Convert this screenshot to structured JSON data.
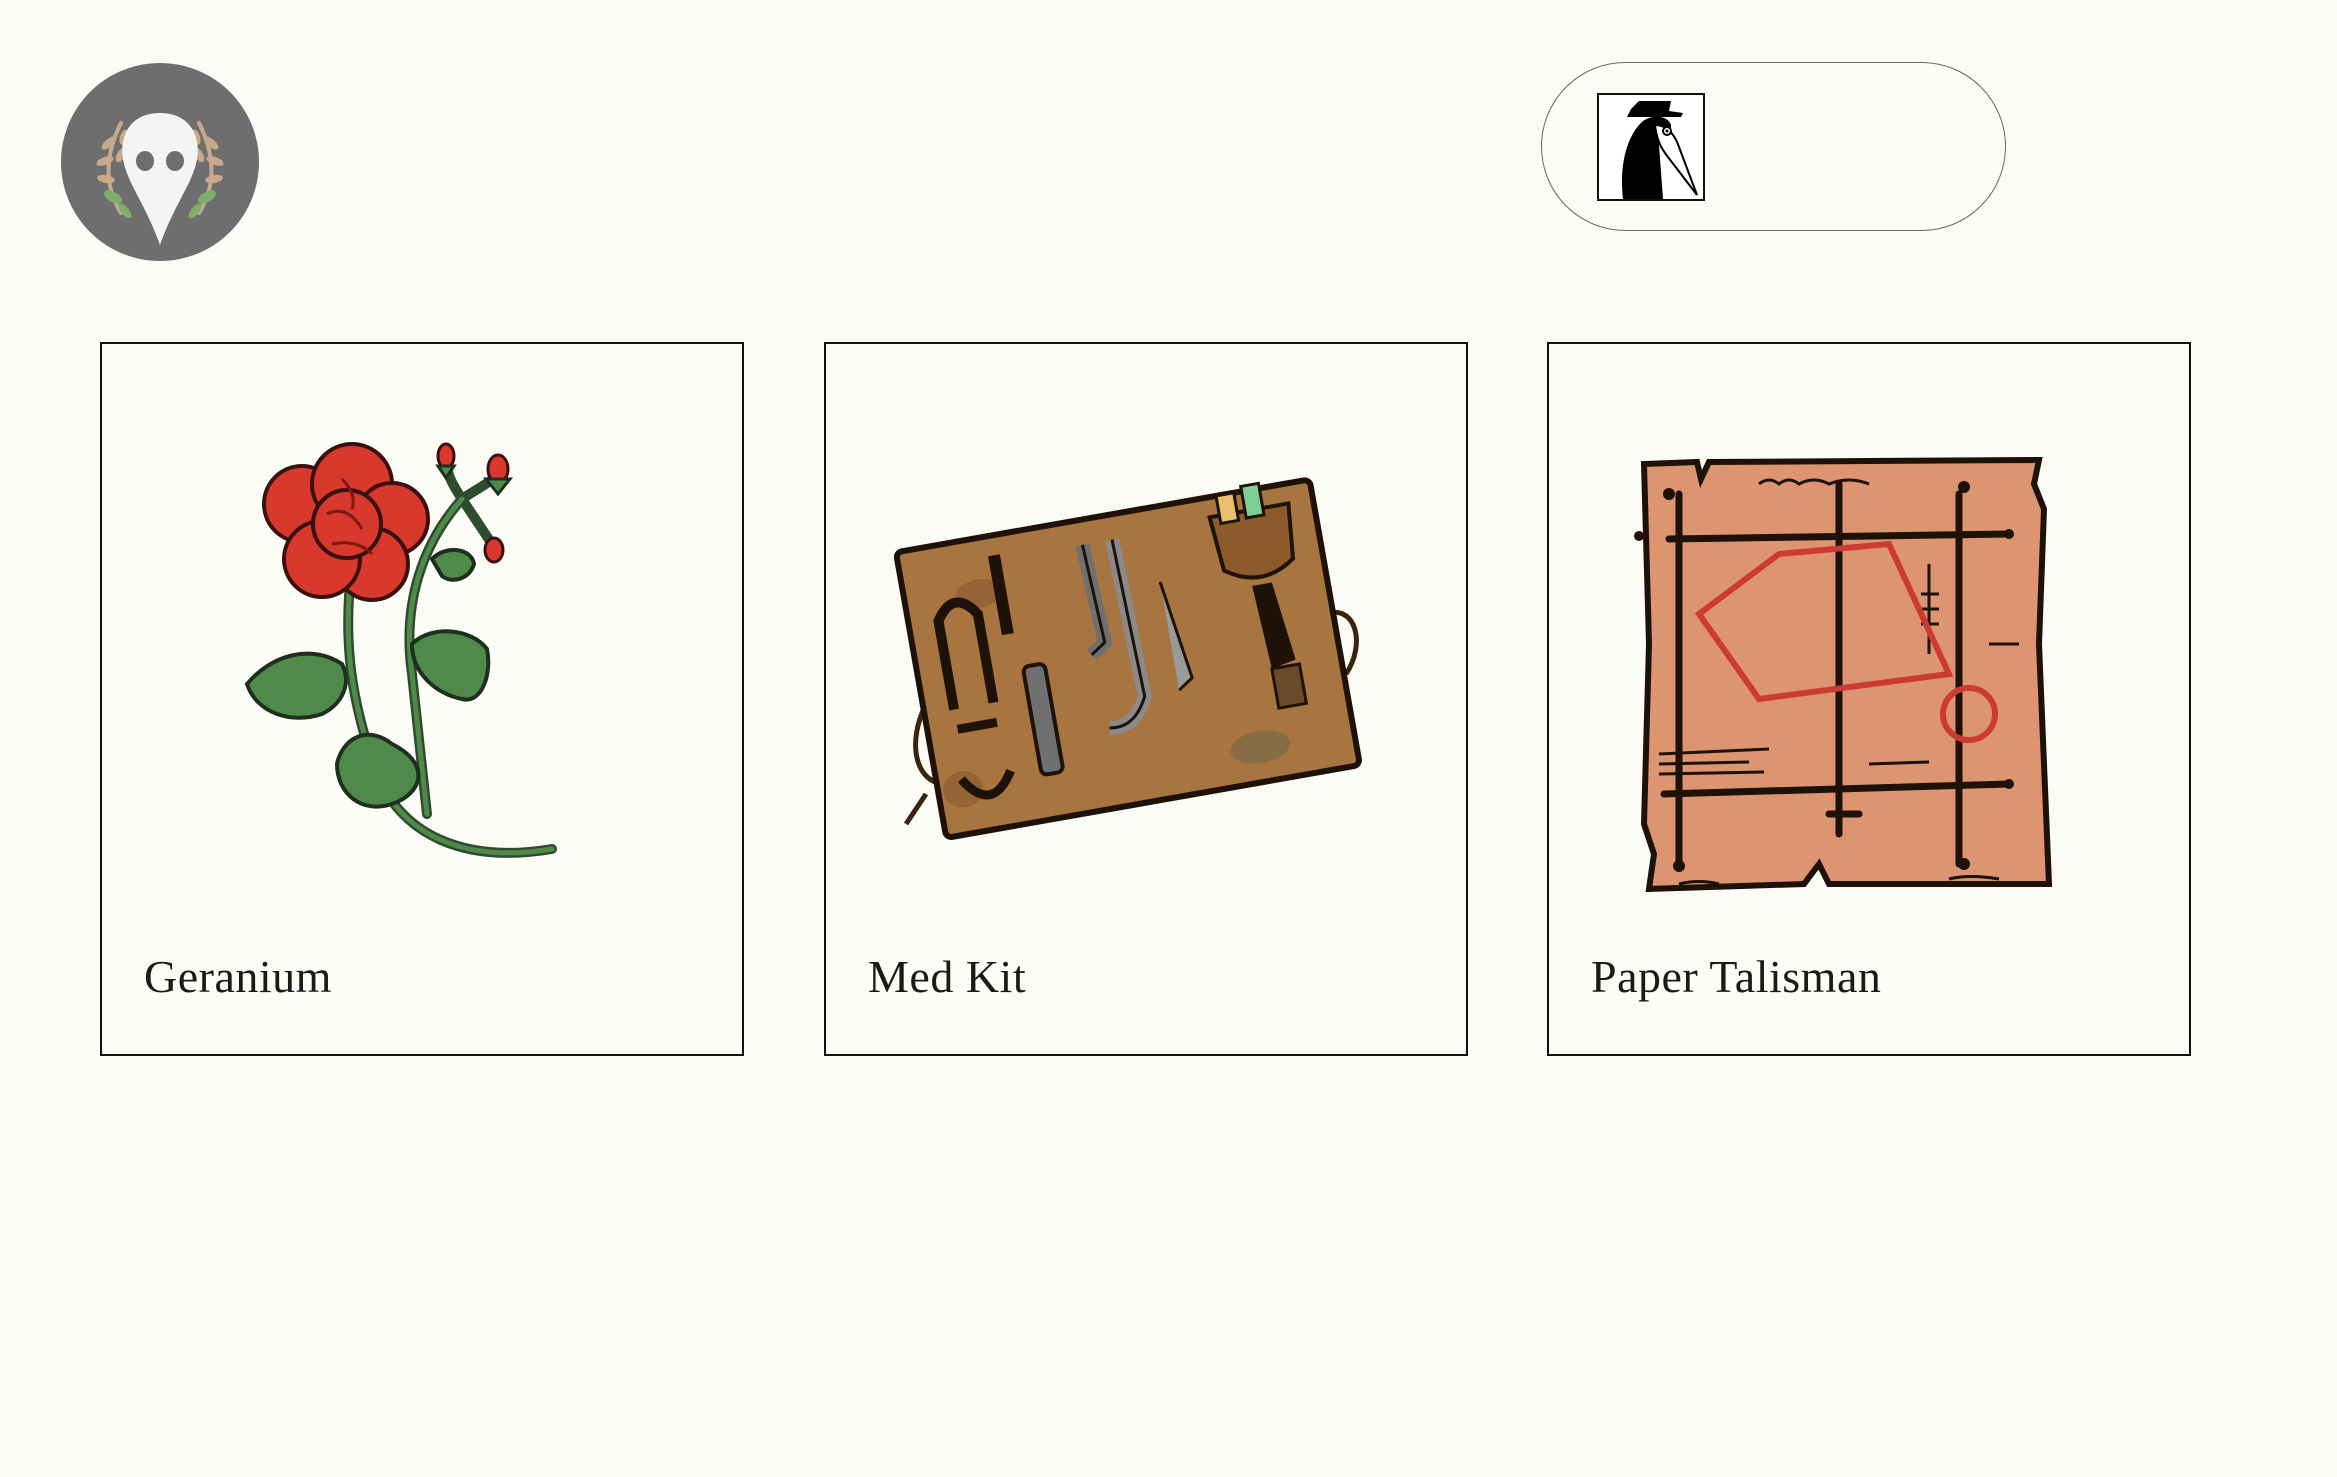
{
  "header": {
    "logo_icon": "plague-mask-laurel-icon",
    "player_avatar_icon": "plague-doctor-avatar-icon"
  },
  "items": [
    {
      "label": "Geranium",
      "icon": "geranium-flower-icon"
    },
    {
      "label": "Med Kit",
      "icon": "med-kit-icon"
    },
    {
      "label": "Paper Talisman",
      "icon": "paper-talisman-icon"
    }
  ],
  "colors": {
    "background": "#fcfcf7",
    "logo_circle": "#6e6e6e",
    "flower_red": "#d8392c",
    "leaf_green": "#4f8a4a",
    "kit_brown": "#a8743f",
    "talisman_paper": "#dd9470",
    "talisman_red": "#cc3b33"
  }
}
